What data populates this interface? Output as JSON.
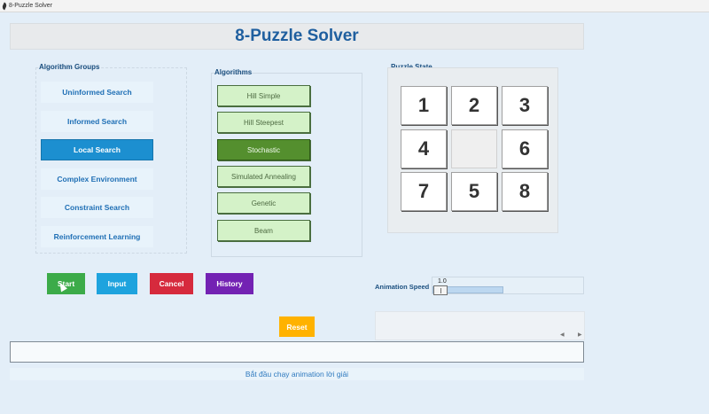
{
  "window": {
    "title": "8-Puzzle Solver"
  },
  "header": {
    "title": "8-Puzzle Solver"
  },
  "groups": {
    "label": "Algorithm Groups",
    "items": [
      {
        "label": "Uninformed Search"
      },
      {
        "label": "Informed Search"
      },
      {
        "label": "Local Search"
      },
      {
        "label": "Complex Environment"
      },
      {
        "label": "Constraint Search"
      },
      {
        "label": "Reinforcement Learning"
      }
    ],
    "selected": "Local Search"
  },
  "algorithms": {
    "label": "Algorithms",
    "items": [
      {
        "label": "Hill Simple"
      },
      {
        "label": "Hill Steepest"
      },
      {
        "label": "Stochastic"
      },
      {
        "label": "Simulated Annealing"
      },
      {
        "label": "Genetic"
      },
      {
        "label": "Beam"
      }
    ],
    "selected": "Stochastic"
  },
  "puzzle": {
    "label": "Puzzle State",
    "tiles": [
      "1",
      "2",
      "3",
      "4",
      "",
      "6",
      "7",
      "5",
      "8"
    ]
  },
  "actions": {
    "start": "Start",
    "input": "Input",
    "cancel": "Cancel",
    "history": "History",
    "reset": "Reset"
  },
  "colors": {
    "start": "#3cab49",
    "input": "#1ea3de",
    "cancel": "#d62a3d",
    "history": "#7322b3",
    "reset": "#ffb200",
    "accent": "#1c8fd0"
  },
  "speed": {
    "label": "Animation Speed",
    "value": "1.0"
  },
  "status": {
    "text": "Bắt đầu chạy animation lời giải"
  }
}
